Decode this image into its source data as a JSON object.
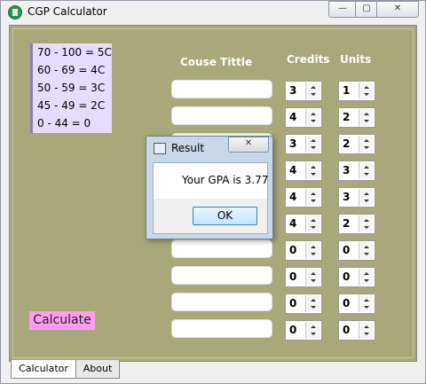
{
  "window": {
    "title": "CGP Calculator",
    "min_glyph": "—",
    "max_glyph": "▢",
    "close_glyph": "✕"
  },
  "grades": [
    "70 - 100 = 5C",
    "60 - 69 = 4C",
    "50 - 59 =  3C",
    "45 - 49 = 2C",
    "0 - 44 = 0"
  ],
  "headers": {
    "course": "Couse Tittle",
    "credits": "Credits",
    "units": "Units"
  },
  "rows": [
    {
      "course": "",
      "credits": "3",
      "units": "1"
    },
    {
      "course": "",
      "credits": "4",
      "units": "2"
    },
    {
      "course": "",
      "credits": "3",
      "units": "2"
    },
    {
      "course": "",
      "credits": "4",
      "units": "3"
    },
    {
      "course": "",
      "credits": "4",
      "units": "3"
    },
    {
      "course": "",
      "credits": "4",
      "units": "2"
    },
    {
      "course": "",
      "credits": "0",
      "units": "0"
    },
    {
      "course": "",
      "credits": "0",
      "units": "0"
    },
    {
      "course": "",
      "credits": "0",
      "units": "0"
    },
    {
      "course": "",
      "credits": "0",
      "units": "0"
    }
  ],
  "calculate_label": "Calculate",
  "tabs": [
    "Calculator",
    "About"
  ],
  "dialog": {
    "title": "Result",
    "message": "Your GPA is 3.77",
    "ok_label": "OK",
    "close_glyph": "✕"
  },
  "colors": {
    "panel": "#a8a87a",
    "grade_box": "#e6dcff",
    "calculate_button": "#ff9ef0"
  }
}
